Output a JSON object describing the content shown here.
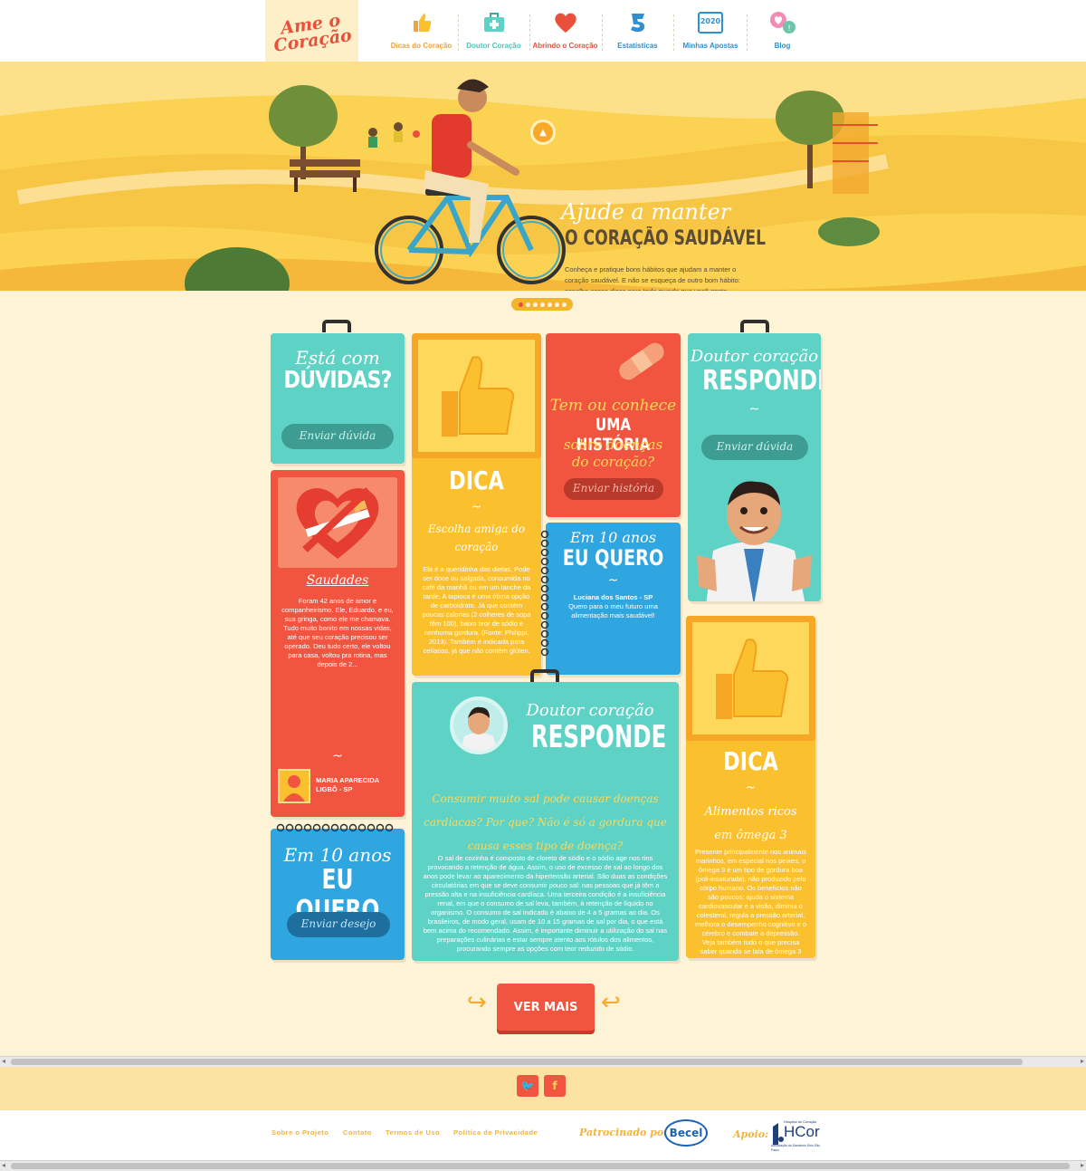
{
  "brand": {
    "logo_line1": "Ame o",
    "logo_line2": "Coração"
  },
  "nav": [
    {
      "label": "Dicas do Coração",
      "icon": "thumbs-up-icon",
      "color": "#f2a33a"
    },
    {
      "label": "Doutor Coração",
      "icon": "medical-kit-icon",
      "color": "#4cc5b8"
    },
    {
      "label": "Abrindo o Coração",
      "icon": "heart-icon",
      "color": "#e8503b"
    },
    {
      "label": "Estatísticas",
      "icon": "statistics-icon",
      "color": "#2f8fcf"
    },
    {
      "label": "Minhas Apostas",
      "icon": "calendar-icon",
      "color": "#2f8fcf"
    },
    {
      "label": "Blog",
      "icon": "blog-hearts-icon",
      "color": "#2f8fcf"
    }
  ],
  "calendar_year": "2020",
  "hero": {
    "title_line1": "Ajude a manter",
    "title_line2": "O CORAÇÃO SAUDÁVEL",
    "text": "Conheça e pratique bons hábitos que ajudam a manter o coração saudável. E não se esqueça de outro bom hábito: espalhe essas dicas para todo mundo que você gosta.",
    "slides_total": 7,
    "slide_active": 1
  },
  "cards": {
    "duvidas": {
      "title1": "Está com",
      "title2": "DÚVIDAS?",
      "button": "Enviar dúvida"
    },
    "historia": {
      "line1": "Tem ou conhece",
      "line2": "UMA HISTÓRIA",
      "line3": "sobre doenças",
      "line4": "do coração?",
      "button": "Enviar história"
    },
    "doutor_top": {
      "title1": "Doutor coração",
      "title2": "RESPONDE",
      "button": "Enviar dúvida"
    },
    "saudades": {
      "title": "Saudades",
      "text": "Foram 42 anos de amor e companheirismo. Ele, Eduardo, e eu, sua gringa, como ele me chamava. Tudo muito bonito em nossas vidas, até que seu coração precisou ser operado. Deu tudo certo, ele voltou para casa, voltou pra rotina, mas depois de 2...",
      "author": "MARIA APARECIDA LIGBÔ - SP"
    },
    "dica1": {
      "label": "DICA",
      "title": "Escolha amiga do coração",
      "text": "Ela é a queridinha das dietas. Pode ser doce ou salgada, consumida no café da manhã ou em um lanche da tarde. A tapioca é uma ótima opção de carboidrato. Já que contém poucas calorias (2 colheres de sopa têm 100), baixo teor de sódio e nenhuma gordura. (Fonte: Philippi, 2013). Também é indicada para celíacos, já que não contém glúten."
    },
    "quero_small": {
      "title1": "Em 10 anos",
      "title2": "EU QUERO",
      "author": "Luciana dos Santos - SP",
      "text": "Quero para o meu futuro uma alimentação mais saudável!"
    },
    "doutor_big": {
      "title1": "Doutor coração",
      "title2": "RESPONDE",
      "question": "Consumir muito sal pode causar doenças cardíacas? Por que? Não é só a gordura que causa esses tipo de doença?",
      "answer": "O sal de cozinha é composto de cloreto de sódio e o sódio age nos rins provocando a retenção de água. Assim, o uso de excesso de sal ao longo dos anos pode levar ao aparecimento da hipertensão arterial. São duas as condições circulatórias em que se deve consumir pouco sal: nas pessoas que já têm a pressão alta e na insuficiência cardíaca. Uma terceira condição é a insuficiência renal, em que o consumo de sal leva, também, à retenção de líquido no organismo. O consumo de sal indicado é abaixo de 4 a 5 gramas ao dia. Os brasileiros, de modo geral, usam de 10 a 15 gramas de sal por dia, o que está bem acima do recomendado. Assim, é importante diminuir a utilização do sal nas preparações culinárias e estar sempre atento aos rótulos dos alimentos, procurando sempre as opções com teor reduzido de sódio."
    },
    "dica2": {
      "label": "DICA",
      "title": "Alimentos ricos em ômega 3",
      "text": "Presente principalmente nos animais marinhos, em especial nos peixes, o ômega 3 é um tipo de gordura boa (poli-insaturada), não produzido pelo corpo humano. Os benefícios não são poucos: ajuda o sistema cardiovascular e a visão, diminui o colesterol, regula a pressão arterial, melhora o desempenho cognitivo e o cérebro e combate a depressão. Veja também tudo o que precisa saber quando se fala de ômega 3"
    },
    "quero_big": {
      "title1": "Em 10 anos",
      "title2": "EU QUERO",
      "button": "Enviar desejo"
    }
  },
  "more_button": "VER MAIS",
  "social": [
    {
      "name": "twitter",
      "glyph": "🐦"
    },
    {
      "name": "facebook",
      "glyph": "f"
    }
  ],
  "footer": {
    "links": [
      "Sobre o Projeto",
      "Contato",
      "Termos de Uso",
      "Política de Privacidade"
    ],
    "sponsor_label": "Patrocinado por:",
    "sponsor_name": "Becel",
    "support_label": "Apoio:",
    "support_top": "Hospital do Coração",
    "support_name": "HCor",
    "support_sub": "Associação do Sanatório Sírio São Paulo"
  },
  "colors": {
    "background": "#fdf3d6",
    "teal": "#5fd2c6",
    "orange": "#f2553f",
    "yellow": "#fbc02d",
    "blue": "#30a6e0",
    "hero": "#fbd252"
  }
}
